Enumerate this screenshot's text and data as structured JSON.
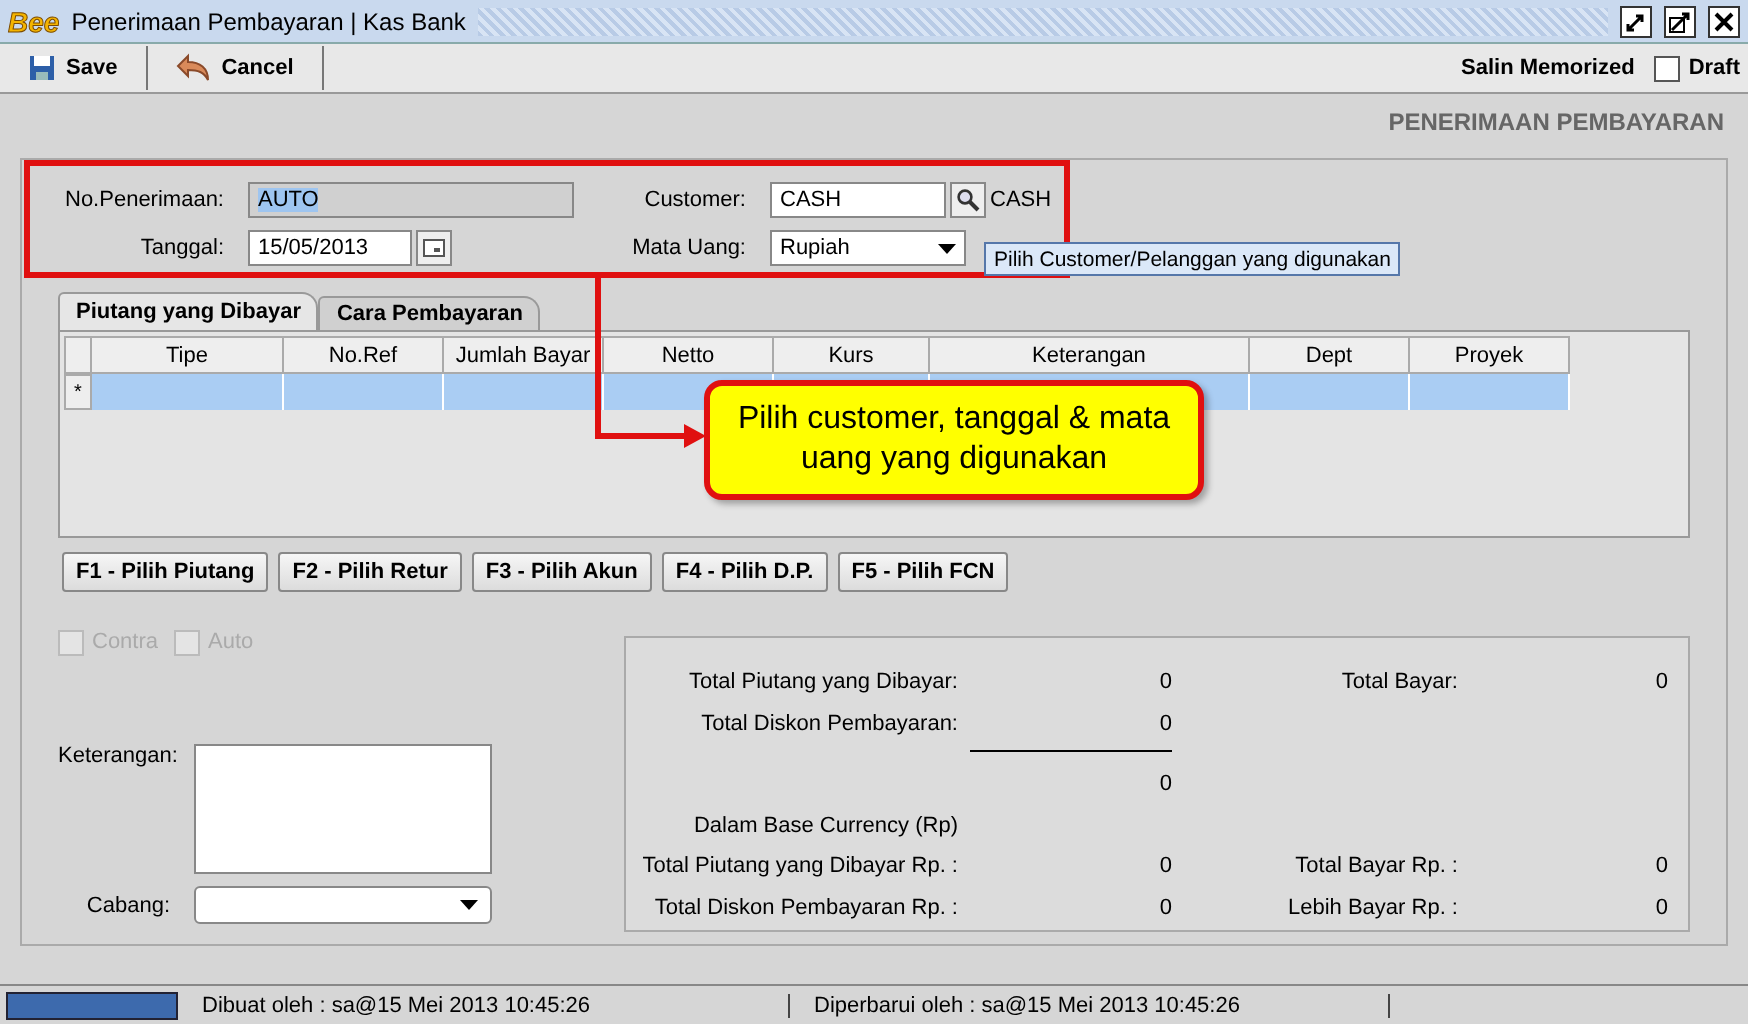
{
  "window": {
    "logo": "Bee",
    "title": "Penerimaan Pembayaran | Kas Bank"
  },
  "toolbar": {
    "buttons": [
      {
        "kind": "save",
        "label": "Save"
      },
      {
        "kind": "cancel",
        "label": "Cancel"
      }
    ],
    "memorized": "Salin Memorized",
    "draft": {
      "label": "Draft",
      "checked": false
    }
  },
  "heading": "PENERIMAAN PEMBAYARAN",
  "form": {
    "no_label": "No.Penerimaan:",
    "no_value": "AUTO",
    "customer_label": "Customer:",
    "customer_value": "CASH",
    "customer_name": "CASH",
    "date_label": "Tanggal:",
    "date_value": "15/05/2013",
    "currency_label": "Mata Uang:",
    "currency_value": "Rupiah"
  },
  "tooltip": "Pilih Customer/Pelanggan yang digunakan",
  "callout": "Pilih customer, tanggal & mata uang yang digunakan",
  "tabs": [
    {
      "label": "Piutang yang Dibayar",
      "selected": true
    },
    {
      "label": "Cara Pembayaran",
      "selected": false
    }
  ],
  "table": {
    "columns": [
      "Tipe",
      "No.Ref",
      "Jumlah Bayar",
      "Netto",
      "Kurs",
      "Keterangan",
      "Dept",
      "Proyek"
    ],
    "rows": [
      {
        "marker": "*",
        "selected": true
      }
    ]
  },
  "actions": [
    "F1 - Pilih Piutang",
    "F2 - Pilih Retur",
    "F3 - Pilih Akun",
    "F4 - Pilih D.P.",
    "F5 - Pilih FCN"
  ],
  "options": [
    {
      "label": "Contra",
      "checked": false,
      "disabled": true
    },
    {
      "label": "Auto",
      "checked": false,
      "disabled": true
    }
  ],
  "notes_label": "Keterangan:",
  "branch_label": "Cabang:",
  "summary": [
    {
      "kind": "pair",
      "label": "Total Piutang yang Dibayar:",
      "value": "0",
      "label_2": "Total Bayar:",
      "value_2": "0"
    },
    {
      "kind": "single",
      "label": "Total Diskon Pembayaran:",
      "value": "0"
    },
    {
      "kind": "rule"
    },
    {
      "kind": "single",
      "value": "0"
    },
    {
      "kind": "caption",
      "label": "Dalam Base Currency (Rp)"
    },
    {
      "kind": "pair",
      "label": "Total Piutang yang Dibayar Rp. :",
      "value": "0",
      "label_2": "Total Bayar Rp. :",
      "value_2": "0"
    },
    {
      "kind": "pair",
      "label": "Total Diskon Pembayaran Rp. :",
      "value": "0",
      "label_2": "Lebih Bayar Rp. :",
      "value_2": "0"
    }
  ],
  "status": [
    "Dibuat oleh : sa@15 Mei 2013  10:45:26",
    "Diperbarui oleh : sa@15 Mei 2013  10:45:26"
  ]
}
